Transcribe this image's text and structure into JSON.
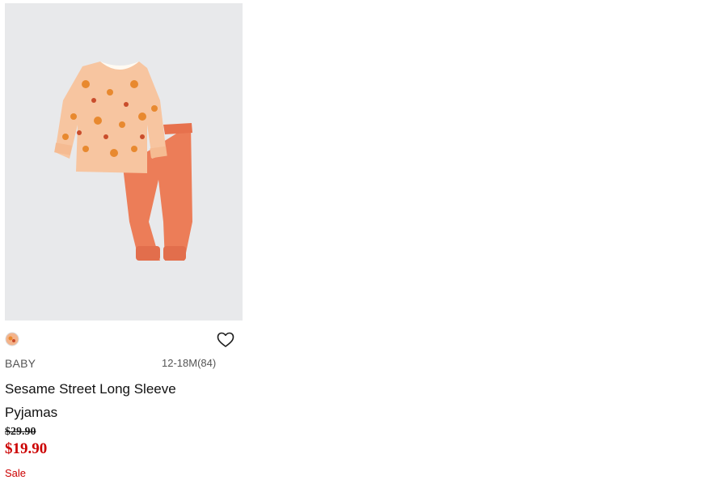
{
  "product": {
    "gender": "BABY",
    "sizes": "12-18M(84)",
    "name": "Sesame Street Long Sleeve Pyjamas",
    "original_price": "$29.90",
    "sale_price": "$19.90",
    "flag": "Sale",
    "image_alt": "Sesame Street Long Sleeve Pyjamas",
    "color_swatches": [
      {
        "name": "orange-print",
        "color": "#f4b38a"
      }
    ],
    "icons": {
      "favorite": "heart-outline-icon"
    }
  },
  "colors": {
    "sale": "#cc0000",
    "image_background": "#e8e9eb",
    "top": "#f7c5a0",
    "pants": "#ec7d58"
  }
}
